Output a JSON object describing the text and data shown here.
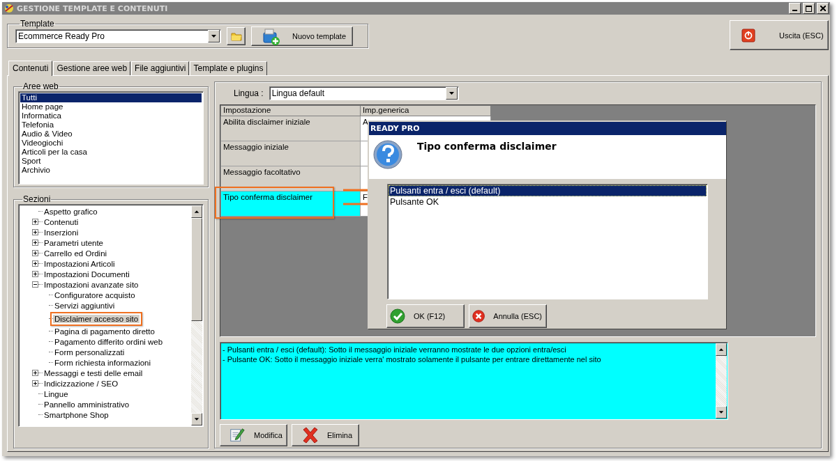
{
  "window": {
    "title": "GESTIONE TEMPLATE E CONTENUTI"
  },
  "template": {
    "label": "Template",
    "value": "Ecommerce Ready Pro",
    "new_button": "Nuovo template"
  },
  "exit_button": "Uscita (ESC)",
  "tabs": [
    {
      "label": "Contenuti",
      "selected": true
    },
    {
      "label": "Gestione aree web",
      "selected": false
    },
    {
      "label": "File aggiuntivi",
      "selected": false
    },
    {
      "label": "Template e plugins",
      "selected": false
    }
  ],
  "web_areas": {
    "label": "Aree web",
    "items": [
      {
        "label": "Tutti",
        "selected": true
      },
      {
        "label": "Home page",
        "selected": false
      },
      {
        "label": "Informatica",
        "selected": false
      },
      {
        "label": "Telefonia",
        "selected": false
      },
      {
        "label": "Audio & Video",
        "selected": false
      },
      {
        "label": "Videogiochi",
        "selected": false
      },
      {
        "label": "Articoli per la casa",
        "selected": false
      },
      {
        "label": "Sport",
        "selected": false
      },
      {
        "label": "Archivio",
        "selected": false
      }
    ]
  },
  "sections": {
    "label": "Sezioni",
    "items": [
      {
        "label": "Aspetto grafico",
        "selected": false
      },
      {
        "label": "Contenuti",
        "selected": false,
        "expanded": false
      },
      {
        "label": "Inserzioni",
        "selected": false,
        "expanded": false
      },
      {
        "label": "Parametri utente",
        "selected": false,
        "expanded": false
      },
      {
        "label": "Carrello ed Ordini",
        "selected": false,
        "expanded": false
      },
      {
        "label": "Impostazioni Articoli",
        "selected": false,
        "expanded": false
      },
      {
        "label": "Impostazioni Documenti",
        "selected": false,
        "expanded": false
      },
      {
        "label": "Impostazioni avanzate sito",
        "selected": false,
        "expanded": true,
        "children": [
          {
            "label": "Configuratore acquisto",
            "selected": false
          },
          {
            "label": "Servizi aggiuntivi",
            "selected": false
          },
          {
            "label": "Disclaimer accesso sito",
            "selected": true,
            "callout": true
          },
          {
            "label": "Pagina di pagamento diretto",
            "selected": false
          },
          {
            "label": "Pagamento differito ordini web",
            "selected": false
          },
          {
            "label": "Form personalizzati",
            "selected": false
          },
          {
            "label": "Form richiesta informazioni",
            "selected": false
          }
        ]
      },
      {
        "label": "Messaggi e testi delle email",
        "selected": false,
        "expanded": false
      },
      {
        "label": "Indicizzazione / SEO",
        "selected": false,
        "expanded": false
      },
      {
        "label": "Lingue",
        "selected": false
      },
      {
        "label": "Pannello amministrativo",
        "selected": false
      },
      {
        "label": "Smartphone Shop",
        "selected": false
      }
    ]
  },
  "language": {
    "label": "Lingua :",
    "value": "Lingua default"
  },
  "grid": {
    "columns": [
      "Impostazione",
      "Imp.generica"
    ],
    "rows": [
      {
        "setting": "Abilita disclaimer iniziale",
        "value_lines": [
          "A"
        ],
        "selected": false
      },
      {
        "setting": "Messaggio iniziale",
        "selected": false
      },
      {
        "setting": "Messaggio facoltativo",
        "selected": false
      },
      {
        "setting": "Tipo conferma disclaimer",
        "value_lines": [
          "F"
        ],
        "selected": true,
        "callout": true
      }
    ]
  },
  "description": [
    "- Pulsanti entra / esci (default): Sotto il messaggio iniziale verranno mostrate le due opzioni entra/esci",
    "- Pulsante OK: Sotto il messaggio iniziale verra' mostrato solamente il pulsante per entrare direttamente nel sito"
  ],
  "actions": [
    {
      "label": "Modifica",
      "kind": "edit"
    },
    {
      "label": "Elimina",
      "kind": "delete"
    }
  ],
  "dialog": {
    "title": "READY PRO",
    "heading": "Tipo conferma disclaimer",
    "options": [
      {
        "label": "Pulsanti entra / esci (default)",
        "selected": true
      },
      {
        "label": "Pulsante OK",
        "selected": false
      }
    ],
    "buttons": [
      {
        "label": "OK (F12)",
        "kind": "ok"
      },
      {
        "label": "Annulla (ESC)",
        "kind": "cancel"
      }
    ]
  }
}
